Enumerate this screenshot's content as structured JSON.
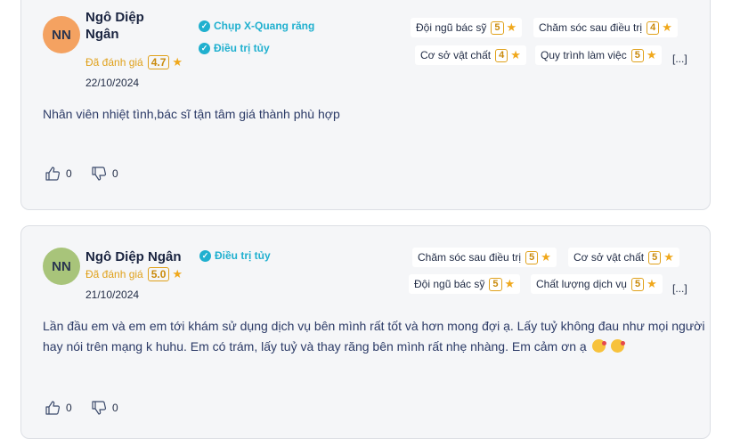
{
  "reviews": [
    {
      "initials": "NN",
      "avatar_color": "#f4a261",
      "name_line1": "Ngô Diệp",
      "name_line2": "Ngân",
      "rated_label": "Đã đánh giá",
      "rating": "4.7",
      "date": "22/10/2024",
      "services": [
        "Chụp X-Quang răng",
        "Điều trị tủy"
      ],
      "criteria": [
        {
          "label": "Đội ngũ bác sỹ",
          "score": "5"
        },
        {
          "label": "Chăm sóc sau điều trị",
          "score": "4"
        },
        {
          "label": "Cơ sở vật chất",
          "score": "4"
        },
        {
          "label": "Quy trình làm việc",
          "score": "5"
        }
      ],
      "more": "[...]",
      "comment": "Nhân viên nhiệt tình,bác sĩ tận tâm giá thành phù hợp",
      "likes": "0",
      "dislikes": "0"
    },
    {
      "initials": "NN",
      "avatar_color": "#a8c47a",
      "name": "Ngô Diệp Ngân",
      "rated_label": "Đã đánh giá",
      "rating": "5.0",
      "date": "21/10/2024",
      "services": [
        "Điều trị tủy"
      ],
      "criteria": [
        {
          "label": "Chăm sóc sau điều trị",
          "score": "5"
        },
        {
          "label": "Cơ sở vật chất",
          "score": "5"
        },
        {
          "label": "Đội ngũ bác sỹ",
          "score": "5"
        },
        {
          "label": "Chất lượng dịch vụ",
          "score": "5"
        }
      ],
      "more": "[...]",
      "comment_line1": "Lần đầu em và em em tới khám sử dụng dịch vụ bên mình rất tốt và hơn mong đợi ạ. Lấy tuỷ không đau như mọi người",
      "comment_line2": "hay nói trên mạng k huhu. Em có trám, lấy tuỷ và thay răng bên mình rất nhẹ nhàng. Em cảm ơn ạ",
      "emojis": [
        "face-blowing-kiss-emoji",
        "face-blowing-kiss-emoji"
      ],
      "likes": "0",
      "dislikes": "0"
    }
  ],
  "colors": {
    "accent": "#20b0cf",
    "rating": "#e0a11b",
    "card_bg": "#f5f6f8"
  }
}
